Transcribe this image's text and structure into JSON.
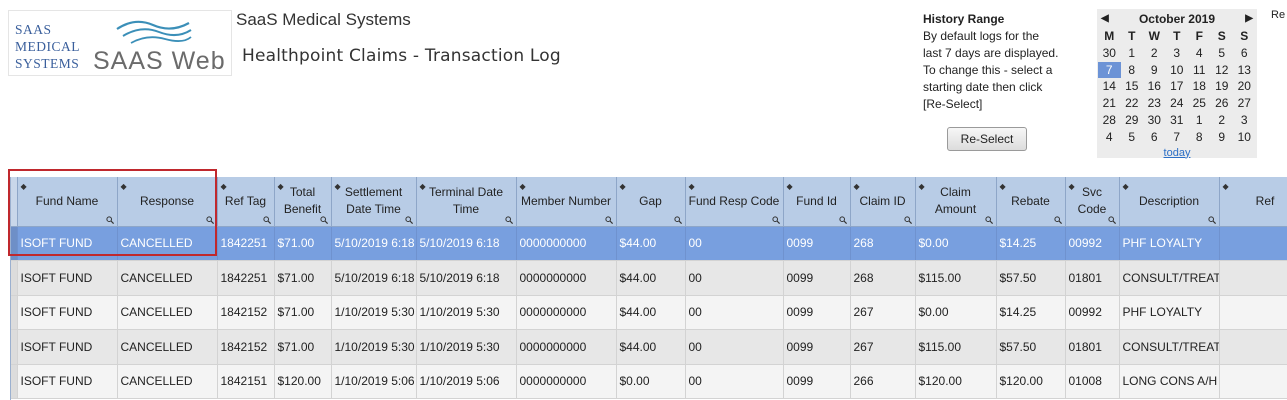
{
  "logo": {
    "left_lines": [
      "SAAS",
      "MEDICAL",
      "SYSTEMS"
    ],
    "right_text": "SAAS Web"
  },
  "header": {
    "company": "SaaS Medical Systems",
    "subtitle": "Healthpoint Claims - Transaction Log"
  },
  "history": {
    "title": "History Range",
    "lines": [
      "By default logs for the",
      "last 7 days are displayed.",
      "To change this - select a",
      "starting date then click",
      "[Re-Select]"
    ],
    "button_label": "Re-Select"
  },
  "calendar": {
    "month": "October 2019",
    "prev_icon": "◀",
    "next_icon": "▶",
    "days_of_week": [
      "M",
      "T",
      "W",
      "T",
      "F",
      "S",
      "S"
    ],
    "weeks": [
      [
        "30",
        "1",
        "2",
        "3",
        "4",
        "5",
        "6"
      ],
      [
        "7",
        "8",
        "9",
        "10",
        "11",
        "12",
        "13"
      ],
      [
        "14",
        "15",
        "16",
        "17",
        "18",
        "19",
        "20"
      ],
      [
        "21",
        "22",
        "23",
        "24",
        "25",
        "26",
        "27"
      ],
      [
        "28",
        "29",
        "30",
        "31",
        "1",
        "2",
        "3"
      ],
      [
        "4",
        "5",
        "6",
        "7",
        "8",
        "9",
        "10"
      ]
    ],
    "selected_day": "7",
    "today_label": "today"
  },
  "edge_text": "Re",
  "table": {
    "columns": [
      "Fund Name",
      "Response",
      "Ref Tag",
      "Total Benefit",
      "Settlement Date Time",
      "Terminal Date Time",
      "Member Number",
      "Gap",
      "Fund Resp Code",
      "Fund Id",
      "Claim ID",
      "Claim Amount",
      "Rebate",
      "Svc Code",
      "Description",
      "Ref"
    ],
    "rows": [
      [
        "ISOFT FUND",
        "CANCELLED",
        "1842251",
        "$71.00",
        "5/10/2019 6:18",
        "5/10/2019 6:18",
        "0000000000",
        "$44.00",
        "00",
        "0099",
        "268",
        "$0.00",
        "$14.25",
        "00992",
        "PHF LOYALTY",
        ""
      ],
      [
        "ISOFT FUND",
        "CANCELLED",
        "1842251",
        "$71.00",
        "5/10/2019 6:18",
        "5/10/2019 6:18",
        "0000000000",
        "$44.00",
        "00",
        "0099",
        "268",
        "$115.00",
        "$57.50",
        "01801",
        "CONSULT/TREAT",
        ""
      ],
      [
        "ISOFT FUND",
        "CANCELLED",
        "1842152",
        "$71.00",
        "1/10/2019 5:30",
        "1/10/2019 5:30",
        "0000000000",
        "$44.00",
        "00",
        "0099",
        "267",
        "$0.00",
        "$14.25",
        "00992",
        "PHF LOYALTY",
        ""
      ],
      [
        "ISOFT FUND",
        "CANCELLED",
        "1842152",
        "$71.00",
        "1/10/2019 5:30",
        "1/10/2019 5:30",
        "0000000000",
        "$44.00",
        "00",
        "0099",
        "267",
        "$115.00",
        "$57.50",
        "01801",
        "CONSULT/TREAT",
        ""
      ],
      [
        "ISOFT FUND",
        "CANCELLED",
        "1842151",
        "$120.00",
        "1/10/2019 5:06",
        "1/10/2019 5:06",
        "0000000000",
        "$0.00",
        "00",
        "0099",
        "266",
        "$120.00",
        "$120.00",
        "01008",
        "LONG CONS A/H",
        ""
      ]
    ],
    "selected_row": 0
  },
  "colors": {
    "header_bg": "#b8cce6",
    "selected_row": "#789fdf",
    "highlight": "#c0282d"
  }
}
